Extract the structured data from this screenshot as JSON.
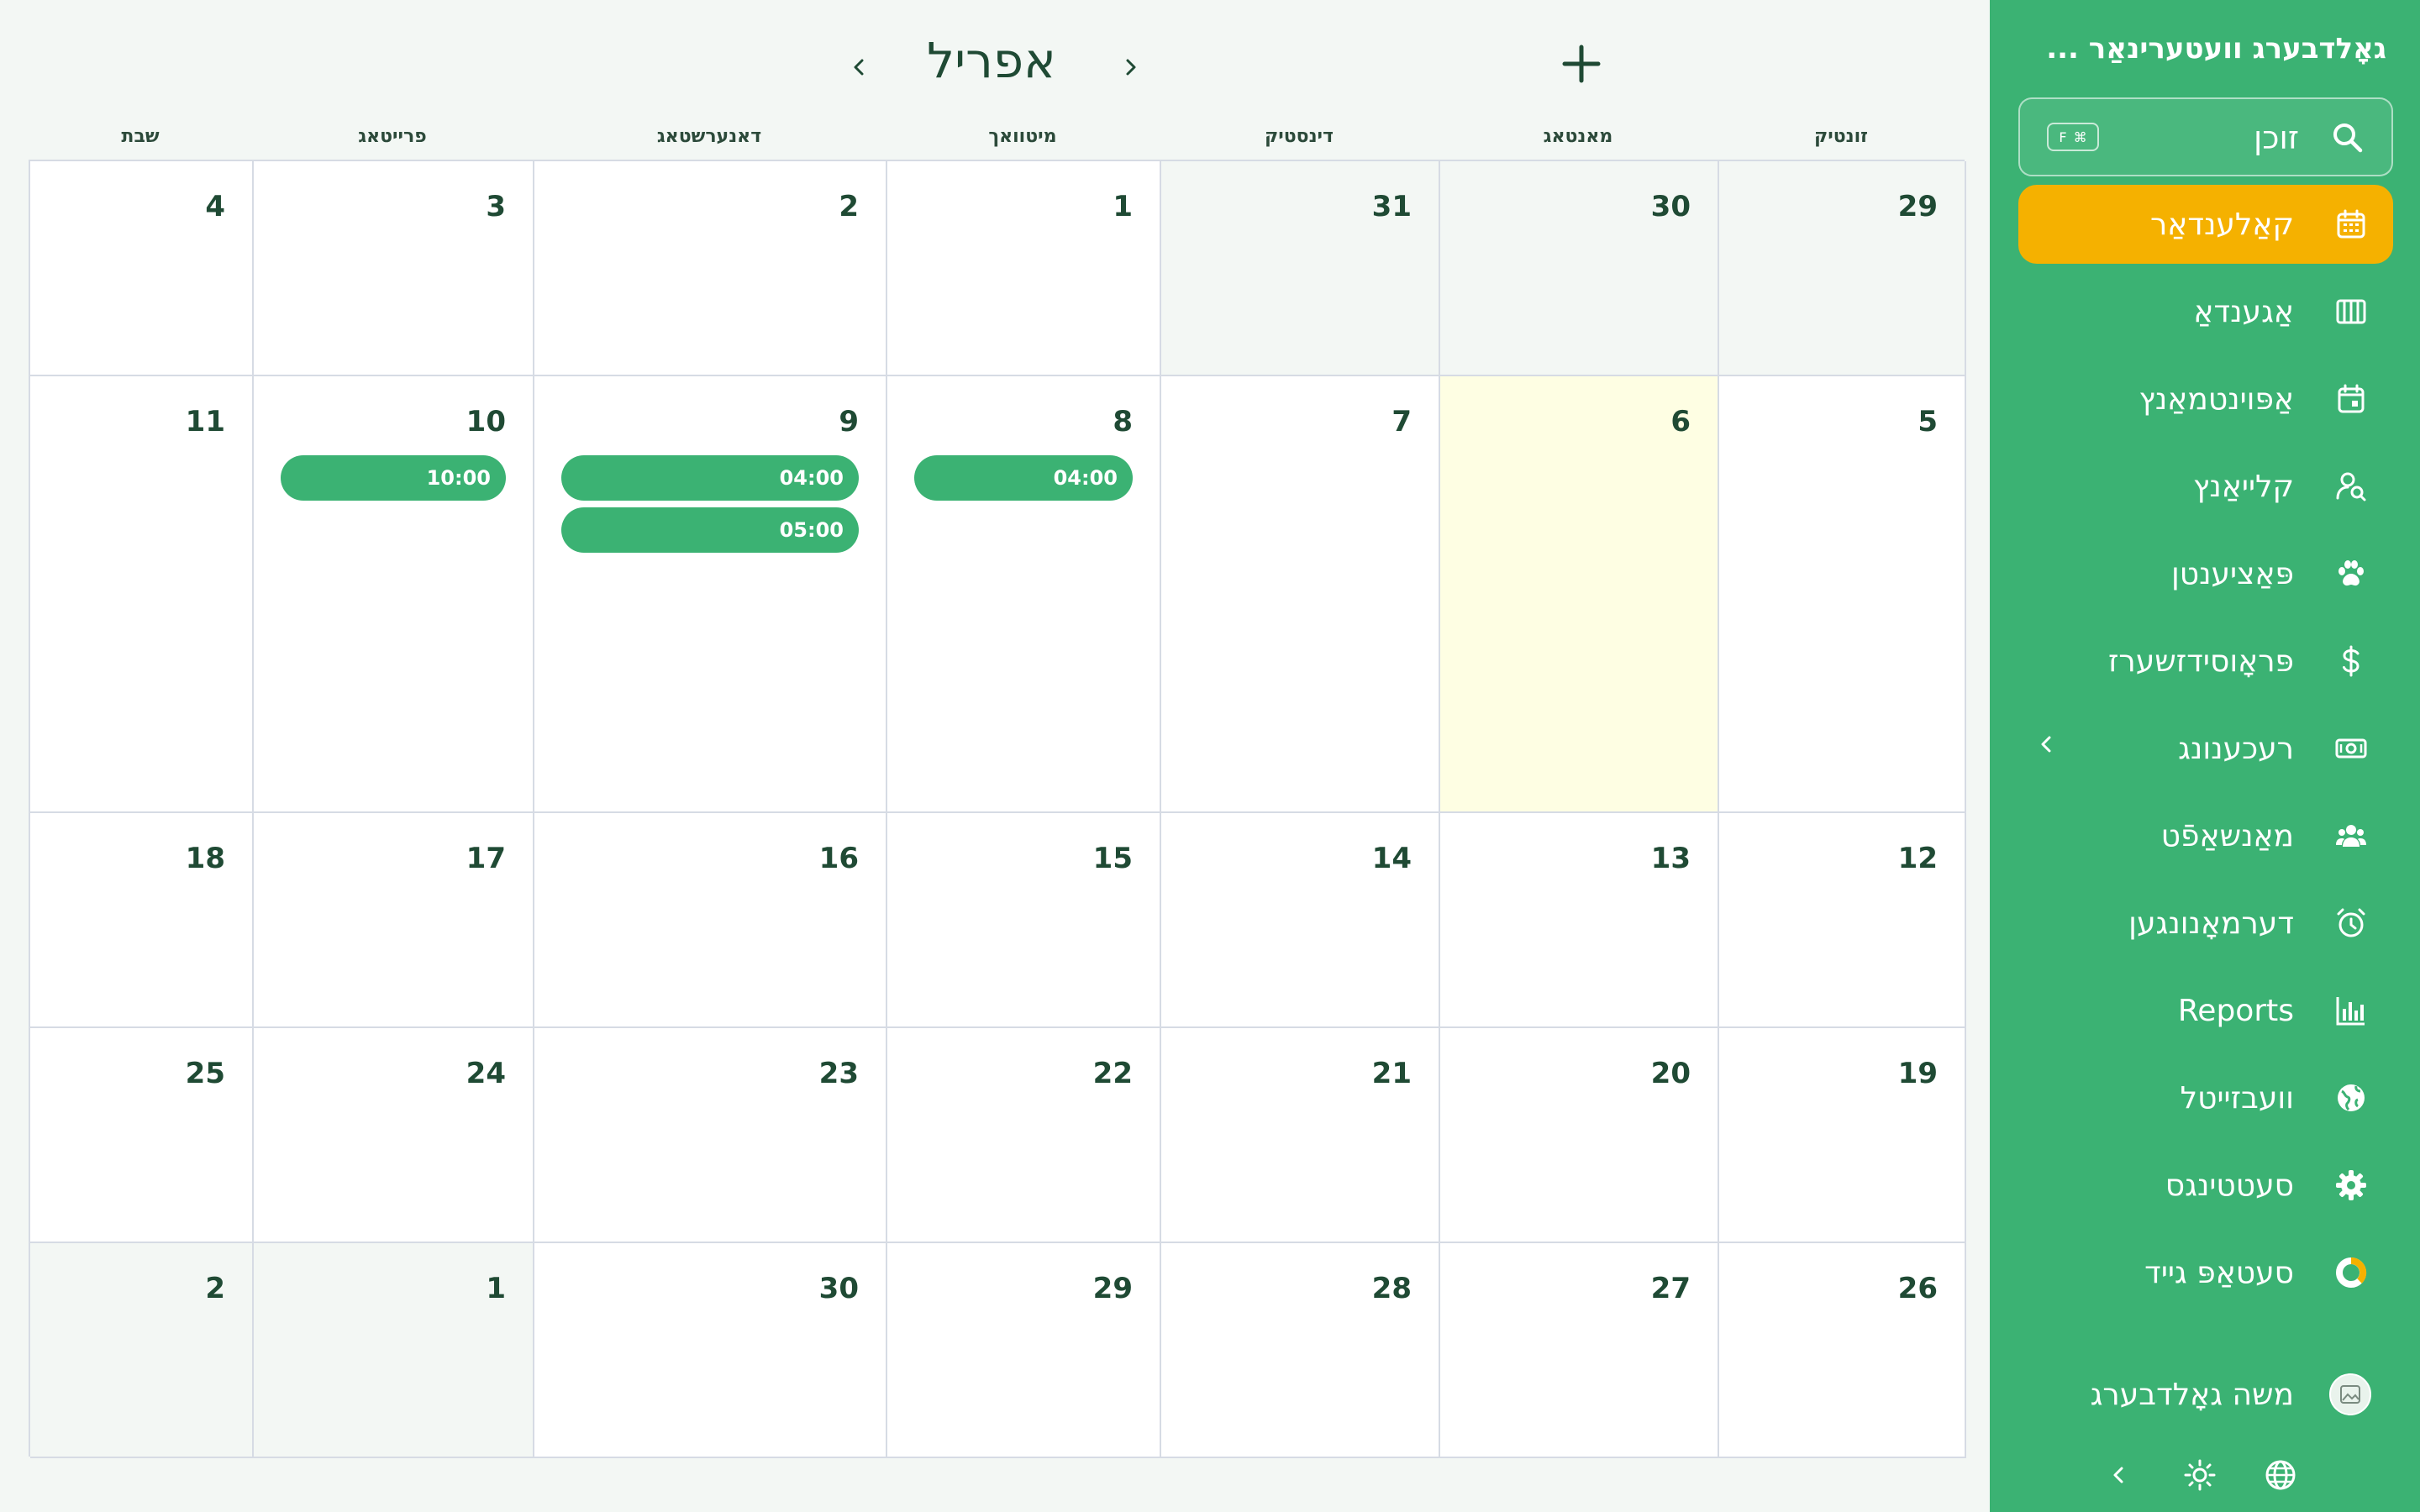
{
  "sidebar": {
    "clinic_name": "גאָלדבערג וועטערינאַר ...",
    "search": {
      "label": "זוכן",
      "shortcut_key": "F",
      "shortcut_mod": "⌘"
    },
    "items": [
      {
        "label": "קאַלענדאַר",
        "icon": "calendar-icon",
        "active": true
      },
      {
        "label": "אַגענדאַ",
        "icon": "agenda-columns-icon"
      },
      {
        "label": "אַפּוינטמאַנץ",
        "icon": "calendar-event-icon"
      },
      {
        "label": "קלייאַנץ",
        "icon": "user-search-icon"
      },
      {
        "label": "פּאַציענטן",
        "icon": "paw-icon"
      },
      {
        "label": "פּראָוסידזשערז",
        "icon": "dollar-icon"
      },
      {
        "label": "רעכענונג",
        "icon": "banknote-icon",
        "has_chevron": true
      },
      {
        "label": "מאַנשאַפֿט",
        "icon": "users-icon"
      },
      {
        "label": "דערמאָנונגען",
        "icon": "alarm-clock-icon"
      },
      {
        "label": "Reports",
        "icon": "bar-chart-icon"
      },
      {
        "label": "וועבזייטל",
        "icon": "globe-icon"
      },
      {
        "label": "סעטטינגס",
        "icon": "gear-icon"
      },
      {
        "label": "סעטאַפּ גייד",
        "icon": "progress-ring-icon"
      }
    ],
    "user": {
      "name": "משה גאָלדבערג"
    },
    "colors": {
      "background": "#3bb273",
      "active": "#f5b100"
    }
  },
  "calendar": {
    "month": "אפריל",
    "weekdays": [
      "זונטיק",
      "מאנטאג",
      "דינסטיק",
      "מיטוואך",
      "דאנערשטאג",
      "פרייטאג",
      "שבת"
    ],
    "weeks": [
      [
        {
          "d": "29",
          "o": true
        },
        {
          "d": "30",
          "o": true
        },
        {
          "d": "31",
          "o": true
        },
        {
          "d": "1"
        },
        {
          "d": "2"
        },
        {
          "d": "3"
        },
        {
          "d": "4"
        }
      ],
      [
        {
          "d": "5"
        },
        {
          "d": "6",
          "today": true
        },
        {
          "d": "7"
        },
        {
          "d": "8",
          "events": [
            "04:00"
          ]
        },
        {
          "d": "9",
          "events": [
            "04:00",
            "05:00"
          ]
        },
        {
          "d": "10",
          "events": [
            "10:00"
          ]
        },
        {
          "d": "11"
        }
      ],
      [
        {
          "d": "12"
        },
        {
          "d": "13"
        },
        {
          "d": "14"
        },
        {
          "d": "15"
        },
        {
          "d": "16"
        },
        {
          "d": "17"
        },
        {
          "d": "18"
        }
      ],
      [
        {
          "d": "19"
        },
        {
          "d": "20"
        },
        {
          "d": "21"
        },
        {
          "d": "22"
        },
        {
          "d": "23"
        },
        {
          "d": "24"
        },
        {
          "d": "25"
        }
      ],
      [
        {
          "d": "26"
        },
        {
          "d": "27"
        },
        {
          "d": "28"
        },
        {
          "d": "29"
        },
        {
          "d": "30"
        },
        {
          "d": "1",
          "o": true
        },
        {
          "d": "2",
          "o": true
        }
      ]
    ],
    "colors": {
      "event": "#3bb273",
      "today": "#fefee3",
      "outside_month": "#f3f7f4"
    }
  }
}
